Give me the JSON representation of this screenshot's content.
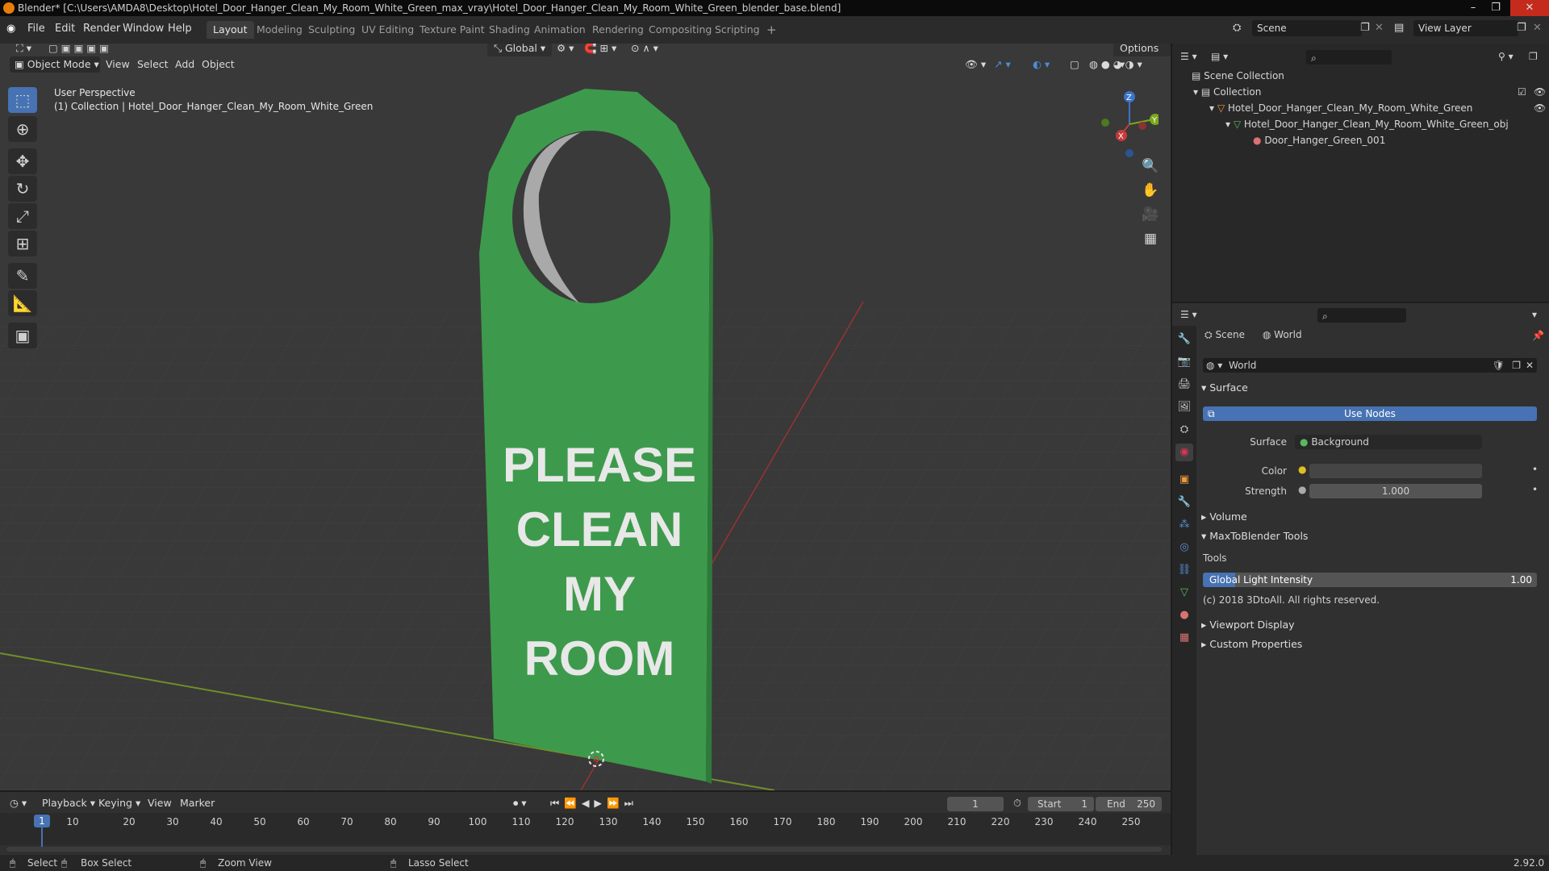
{
  "window": {
    "title": "Blender* [C:\\Users\\AMDA8\\Desktop\\Hotel_Door_Hanger_Clean_My_Room_White_Green_max_vray\\Hotel_Door_Hanger_Clean_My_Room_White_Green_blender_base.blend]"
  },
  "menu": [
    "File",
    "Edit",
    "Render",
    "Window",
    "Help"
  ],
  "workspaces": [
    "Layout",
    "Modeling",
    "Sculpting",
    "UV Editing",
    "Texture Paint",
    "Shading",
    "Animation",
    "Rendering",
    "Compositing",
    "Scripting"
  ],
  "active_workspace": "Layout",
  "top_right": {
    "scene": "Scene",
    "view_layer": "View Layer"
  },
  "viewport": {
    "transform_orientation": "Global",
    "options_label": "Options",
    "mode": "Object Mode",
    "header_menus": [
      "View",
      "Select",
      "Add",
      "Object"
    ],
    "overlay_title": "User Perspective",
    "overlay_subtitle": "(1) Collection | Hotel_Door_Hanger_Clean_My_Room_White_Green",
    "model_text": [
      "PLEASE",
      "CLEAN",
      "MY",
      "ROOM"
    ],
    "model_color": "#3d9a4c",
    "axes": {
      "x": "X",
      "y": "Y",
      "z": "Z"
    }
  },
  "outliner": {
    "items": [
      {
        "label": "Scene Collection"
      },
      {
        "label": "Collection"
      },
      {
        "label": "Hotel_Door_Hanger_Clean_My_Room_White_Green"
      },
      {
        "label": "Hotel_Door_Hanger_Clean_My_Room_White_Green_obj"
      },
      {
        "label": "Door_Hanger_Green_001"
      }
    ]
  },
  "properties": {
    "breadcrumb": [
      "Scene",
      "World"
    ],
    "world_name": "World",
    "panels": {
      "surface": "Surface",
      "use_nodes": "Use Nodes",
      "surface_label": "Surface",
      "surface_value": "Background",
      "color_label": "Color",
      "strength_label": "Strength",
      "strength_value": "1.000",
      "volume": "Volume",
      "maxtoblender": "MaxToBlender Tools",
      "tools": "Tools",
      "global_light_label": "Global Light Intensity",
      "global_light_highlight": "Global",
      "global_light_value": "1.00",
      "copyright": "(c) 2018 3DtoAll. All rights reserved.",
      "viewport_display": "Viewport Display",
      "custom_properties": "Custom Properties"
    }
  },
  "timeline": {
    "menus": [
      "Playback",
      "Keying",
      "View",
      "Marker"
    ],
    "current_frame": "1",
    "start_label": "Start",
    "start": "1",
    "end_label": "End",
    "end": "250",
    "ticks": [
      "1",
      "10",
      "20",
      "30",
      "40",
      "50",
      "60",
      "70",
      "80",
      "90",
      "100",
      "110",
      "120",
      "130",
      "140",
      "150",
      "160",
      "170",
      "180",
      "190",
      "200",
      "210",
      "220",
      "230",
      "240",
      "250"
    ]
  },
  "statusbar": {
    "select": "Select",
    "box_select": "Box Select",
    "zoom_view": "Zoom View",
    "lasso_select": "Lasso Select",
    "version": "2.92.0"
  }
}
